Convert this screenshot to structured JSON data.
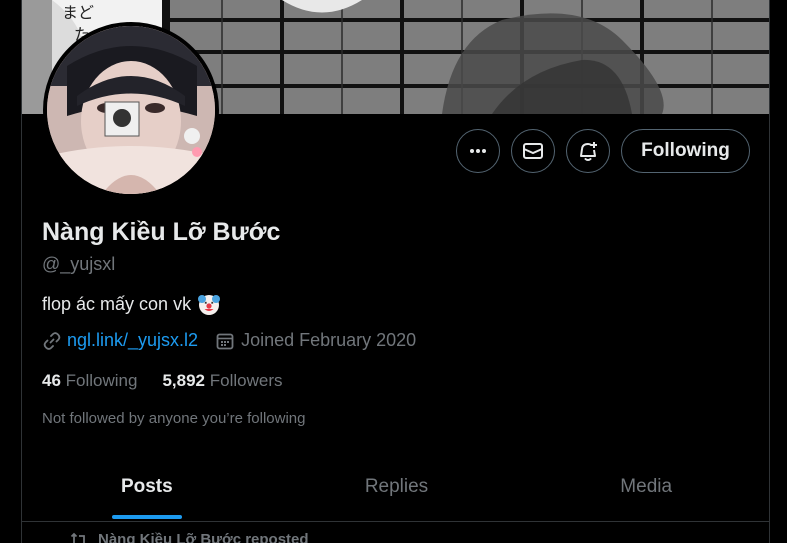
{
  "profile": {
    "name": "Nàng Kiều Lỡ Bước",
    "handle": "@_yujsxl",
    "bio": "flop ác mấy con vk",
    "bio_emoji": "clown-face-icon",
    "link": "ngl.link/_yujsx.l2",
    "joined": "Joined February 2020",
    "following_count": "46",
    "following_label": "Following",
    "followers_count": "5,892",
    "followers_label": "Followers",
    "not_followed": "Not followed by anyone you’re following"
  },
  "actions": {
    "more_icon": "more-icon",
    "message_icon": "envelope-icon",
    "notify_icon": "bell-plus-icon",
    "follow_label": "Following"
  },
  "tabs": [
    {
      "label": "Posts",
      "active": true
    },
    {
      "label": "Replies",
      "active": false
    },
    {
      "label": "Media",
      "active": false
    }
  ],
  "timeline": {
    "repost_text": "Nàng Kiều Lỡ Bước reposted"
  },
  "colors": {
    "background": "#000000",
    "accent": "#1d9bf0",
    "text": "#e7e9ea",
    "muted": "#71767b",
    "border": "#2f3336"
  }
}
